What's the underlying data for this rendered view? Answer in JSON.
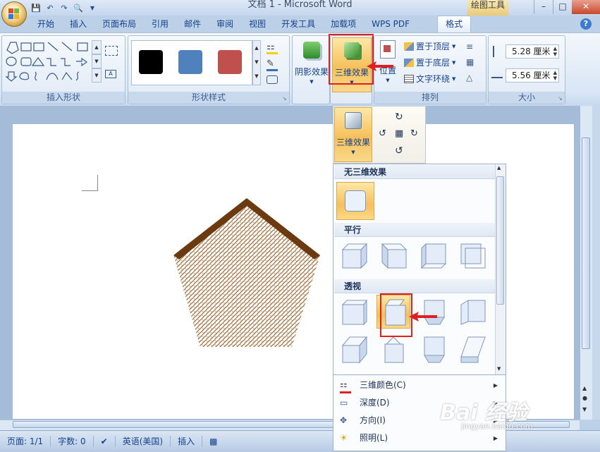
{
  "window": {
    "title": "文档 1 - Microsoft Word",
    "contextual_tab_title": "绘图工具",
    "controls": [
      "minimize",
      "maximize",
      "close"
    ]
  },
  "qat": {
    "icons": [
      "save-icon",
      "undo-icon",
      "redo-icon",
      "print-preview-icon",
      "customize-icon"
    ]
  },
  "ribbon": {
    "tabs": [
      "开始",
      "插入",
      "页面布局",
      "引用",
      "邮件",
      "审阅",
      "视图",
      "开发工具",
      "加载项",
      "WPS PDF",
      "格式"
    ],
    "active_tab": "格式",
    "help": "?",
    "groups": {
      "insert_shapes": {
        "label": "插入形状"
      },
      "shape_styles": {
        "label": "形状样式",
        "swatches": [
          "#000000",
          "#4f81bd",
          "#c0504d"
        ]
      },
      "shadow": {
        "label": "阴影效果"
      },
      "threed": {
        "label": "三维效果"
      },
      "arrange": {
        "label": "排列",
        "position": "位置",
        "bring_front": "置于顶层",
        "send_back": "置于底层",
        "text_wrap": "文字环绕"
      },
      "size": {
        "label": "大小",
        "height": "5.28 厘米",
        "width": "5.56 厘米"
      }
    }
  },
  "dropdown": {
    "header_button": "三维效果",
    "sections": {
      "none": "无三维效果",
      "parallel": "平行",
      "perspective": "透视"
    },
    "menu": [
      {
        "label": "三维颜色(C)",
        "icon": "paint-bucket-icon"
      },
      {
        "label": "深度(D)",
        "icon": "depth-icon"
      },
      {
        "label": "方向(I)",
        "icon": "direction-icon"
      },
      {
        "label": "照明(L)",
        "icon": "lighting-icon"
      }
    ]
  },
  "statusbar": {
    "page": "页面: 1/1",
    "words": "字数: 0",
    "language": "英语(美国)",
    "mode": "插入"
  },
  "watermark": {
    "main": "Bai 经验",
    "sub": "jingyan.baidu.com"
  },
  "colors": {
    "pentagon_fill": "#8a5a2b",
    "pentagon_top": "#6b3a10",
    "highlight_box": "#e02020",
    "accent": "#f7c05a"
  }
}
